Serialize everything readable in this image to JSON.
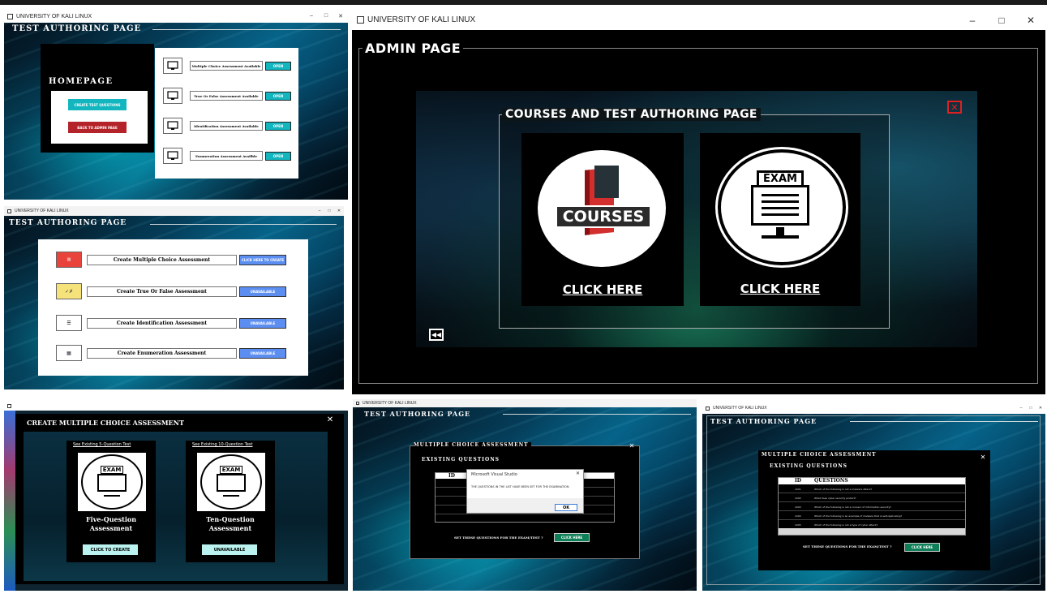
{
  "win_a": {
    "title": "UNIVERSITY OF KALI LINUX",
    "heading": "TEST AUTHORING PAGE",
    "homepage_label": "HOMEPAGE",
    "create_btn": "CREATE TEST QUESTIONS",
    "back_btn": "BACK TO ADMIN PAGE",
    "rows": [
      {
        "label": "Multiple Choice Assessment Available",
        "btn": "OPEN"
      },
      {
        "label": "True Or False Assessment Available",
        "btn": "OPEN"
      },
      {
        "label": "Identification Assessment Available",
        "btn": "OPEN"
      },
      {
        "label": "Enumeration Assessment Availble",
        "btn": "OPEN"
      }
    ]
  },
  "win_b": {
    "title": "UNIVERSITY OF KALI LINUX",
    "heading": "TEST AUTHORING PAGE",
    "rows": [
      {
        "label": "Create Multiple Choice Assessment",
        "btn": "CLICK HERE TO CREATE"
      },
      {
        "label": "Create True Or False Assessment",
        "btn": "UNAVAILABLE"
      },
      {
        "label": "Create Identification Assessment",
        "btn": "UNAVAILABLE"
      },
      {
        "label": "Create Enumeration Assessment",
        "btn": "UNAVAILABLE"
      }
    ]
  },
  "admin": {
    "title": "UNIVERSITY OF KALI LINUX",
    "heading": "ADMIN PAGE",
    "panel_title": "COURSES AND TEST AUTHORING PAGE",
    "courses_text": "COURSES",
    "exam_text": "EXAM",
    "click_courses": "CLICK HERE",
    "click_exam": "CLICK HERE",
    "close": "✕",
    "back": "◀◀"
  },
  "win_c": {
    "heading": "CREATE MULTIPLE CHOICE ASSESSMENT",
    "left_link": "See Existing 5-Question Test",
    "right_link": "See Existing 10-Question Test",
    "left_name": "Five-Question Assessment",
    "right_name": "Ten-Question Assessment",
    "left_btn": "CLICK TO CREATE",
    "right_btn": "UNAVAILABLE",
    "exam": "EXAM",
    "close": "✕"
  },
  "win_d": {
    "title": "UNIVERSITY OF KALI LINUX",
    "heading": "TEST AUTHORING PAGE",
    "panel": "MULTIPLE CHOICE ASSESSMENT",
    "sub": "EXISTING QUESTIONS",
    "col_id": "ID",
    "dialog_title": "Microsoft Visual Studio",
    "dialog_msg": "THE QUESTIONS IN THE LIST HAVE BEEN SET FOR THE EXAMINATION",
    "dialog_ok": "OK",
    "footer_q": "SET THESE QUESTIONS FOR THE EXAM/TEST ?",
    "footer_btn": "CLICK HERE",
    "close": "✕"
  },
  "win_e": {
    "title": "UNIVERSITY OF KALI LINUX",
    "heading": "TEST AUTHORING PAGE",
    "panel": "MULTIPLE CHOICE ASSESSMENT",
    "sub": "EXISTING QUESTIONS",
    "col_id": "ID",
    "col_q": "QUESTIONS",
    "rows": [
      {
        "id": "1001",
        "q": "Which of the following is not a malware attack?"
      },
      {
        "id": "1002",
        "q": "What does cyber security protect?"
      },
      {
        "id": "1003",
        "q": "Which of the following is not a concern of information security?"
      },
      {
        "id": "1004",
        "q": "Which of the following is an example of malware that is self-replicating?"
      },
      {
        "id": "1005",
        "q": "Which of the following is not a type of cyber attack?"
      }
    ],
    "footer_q": "SET THESE QUESTIONS FOR THE EXAM/TEST ?",
    "footer_btn": "CLICK HERE",
    "close": "✕"
  },
  "colors": {
    "teal_btn": "#13b6bf",
    "red_btn": "#b5232a",
    "blue_btn": "#5b8ef0",
    "light_cyan_btn": "#b9f2ee",
    "green_btn": "#0e7f57"
  }
}
